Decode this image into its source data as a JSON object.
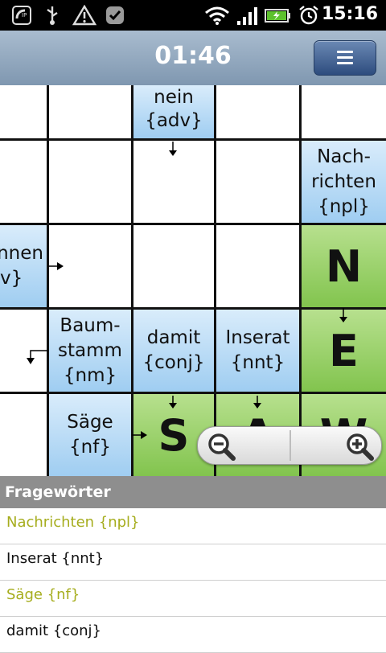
{
  "status_bar": {
    "time": "15:16",
    "icons": [
      "voip-icon",
      "usb-icon",
      "warning-icon",
      "check-icon",
      "wifi-icon",
      "signal-icon",
      "battery-charging-icon",
      "alarm-icon"
    ]
  },
  "header": {
    "timer": "01:46",
    "menu_icon": "menu-icon"
  },
  "grid": {
    "clues": {
      "nein": [
        "nein",
        "{adv}"
      ],
      "nachrichten": [
        "Nach-",
        "richten",
        "{npl}"
      ],
      "partial_left": [
        "nnen",
        "v}"
      ],
      "baumstamm": [
        "Baum-",
        "stamm",
        "{nm}"
      ],
      "damit": [
        "damit",
        "{conj}"
      ],
      "inserat": [
        "Inserat",
        "{nnt}"
      ],
      "saege": [
        "Säge",
        "{nf}"
      ]
    },
    "letters": {
      "n": "N",
      "e": "E",
      "s": "S",
      "a": "A",
      "w": "W"
    }
  },
  "zoom": {
    "out_icon": "zoom-out-icon",
    "in_icon": "zoom-in-icon"
  },
  "word_list": {
    "header": "Fragewörter",
    "items": [
      {
        "label": "Nachrichten {npl}",
        "solved": true
      },
      {
        "label": "Inserat {nnt}",
        "solved": false
      },
      {
        "label": "Säge {nf}",
        "solved": true
      },
      {
        "label": "damit {conj}",
        "solved": false
      }
    ]
  },
  "colors": {
    "clue_bg": "#a8d2f3",
    "answer_bg": "#8fcc5c",
    "solved_text": "#a6ad1e",
    "title_bar": "#90a7bf"
  }
}
